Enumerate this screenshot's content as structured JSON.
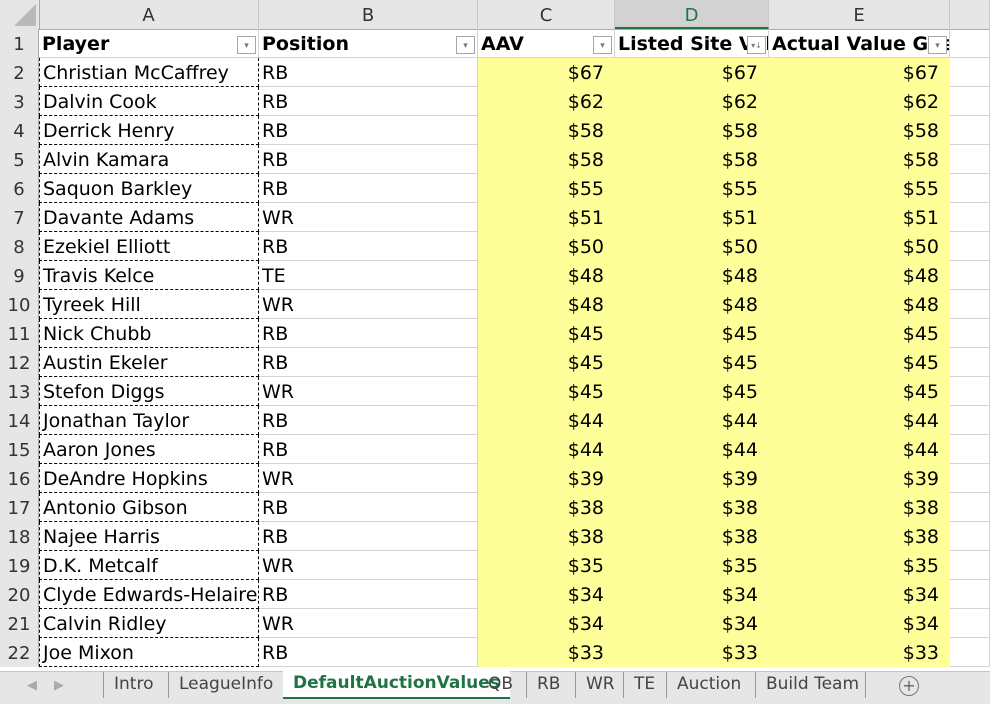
{
  "columns": [
    "A",
    "B",
    "C",
    "D",
    "E"
  ],
  "selected_column": "D",
  "headers": {
    "player": "Player",
    "position": "Position",
    "aav": "AAV",
    "listed": "Listed Site Val",
    "actual": "Actual Value Gue"
  },
  "filter_icons": {
    "player": "dropdown-filter-icon",
    "position": "dropdown-filter-icon",
    "aav": "dropdown-filter-icon",
    "listed": "sort-descending-filter-icon",
    "actual": "dropdown-filter-icon"
  },
  "rows": [
    {
      "n": "2",
      "player": "Christian McCaffrey",
      "pos": "RB",
      "aav": "$67",
      "listed": "$67",
      "actual": "$67"
    },
    {
      "n": "3",
      "player": "Dalvin Cook",
      "pos": "RB",
      "aav": "$62",
      "listed": "$62",
      "actual": "$62"
    },
    {
      "n": "4",
      "player": "Derrick Henry",
      "pos": "RB",
      "aav": "$58",
      "listed": "$58",
      "actual": "$58"
    },
    {
      "n": "5",
      "player": "Alvin Kamara",
      "pos": "RB",
      "aav": "$58",
      "listed": "$58",
      "actual": "$58"
    },
    {
      "n": "6",
      "player": "Saquon Barkley",
      "pos": "RB",
      "aav": "$55",
      "listed": "$55",
      "actual": "$55"
    },
    {
      "n": "7",
      "player": "Davante Adams",
      "pos": "WR",
      "aav": "$51",
      "listed": "$51",
      "actual": "$51"
    },
    {
      "n": "8",
      "player": "Ezekiel Elliott",
      "pos": "RB",
      "aav": "$50",
      "listed": "$50",
      "actual": "$50"
    },
    {
      "n": "9",
      "player": "Travis Kelce",
      "pos": "TE",
      "aav": "$48",
      "listed": "$48",
      "actual": "$48"
    },
    {
      "n": "10",
      "player": "Tyreek Hill",
      "pos": "WR",
      "aav": "$48",
      "listed": "$48",
      "actual": "$48"
    },
    {
      "n": "11",
      "player": "Nick Chubb",
      "pos": "RB",
      "aav": "$45",
      "listed": "$45",
      "actual": "$45"
    },
    {
      "n": "12",
      "player": "Austin Ekeler",
      "pos": "RB",
      "aav": "$45",
      "listed": "$45",
      "actual": "$45"
    },
    {
      "n": "13",
      "player": "Stefon Diggs",
      "pos": "WR",
      "aav": "$45",
      "listed": "$45",
      "actual": "$45"
    },
    {
      "n": "14",
      "player": "Jonathan Taylor",
      "pos": "RB",
      "aav": "$44",
      "listed": "$44",
      "actual": "$44"
    },
    {
      "n": "15",
      "player": "Aaron Jones",
      "pos": "RB",
      "aav": "$44",
      "listed": "$44",
      "actual": "$44"
    },
    {
      "n": "16",
      "player": "DeAndre Hopkins",
      "pos": "WR",
      "aav": "$39",
      "listed": "$39",
      "actual": "$39"
    },
    {
      "n": "17",
      "player": "Antonio Gibson",
      "pos": "RB",
      "aav": "$38",
      "listed": "$38",
      "actual": "$38"
    },
    {
      "n": "18",
      "player": "Najee Harris",
      "pos": "RB",
      "aav": "$38",
      "listed": "$38",
      "actual": "$38"
    },
    {
      "n": "19",
      "player": "D.K. Metcalf",
      "pos": "WR",
      "aav": "$35",
      "listed": "$35",
      "actual": "$35"
    },
    {
      "n": "20",
      "player": "Clyde Edwards-Helaire",
      "pos": "RB",
      "aav": "$34",
      "listed": "$34",
      "actual": "$34"
    },
    {
      "n": "21",
      "player": "Calvin Ridley",
      "pos": "WR",
      "aav": "$34",
      "listed": "$34",
      "actual": "$34"
    },
    {
      "n": "22",
      "player": "Joe Mixon",
      "pos": "RB",
      "aav": "$33",
      "listed": "$33",
      "actual": "$33"
    }
  ],
  "header_row_number": "1",
  "tabs": [
    "Intro",
    "LeagueInfo",
    "DefaultAuctionValues",
    "QB",
    "RB",
    "WR",
    "TE",
    "Auction",
    "Build Team"
  ],
  "active_tab": "DefaultAuctionValues",
  "colors": {
    "highlight": "#ffff99",
    "accent": "#217346"
  }
}
